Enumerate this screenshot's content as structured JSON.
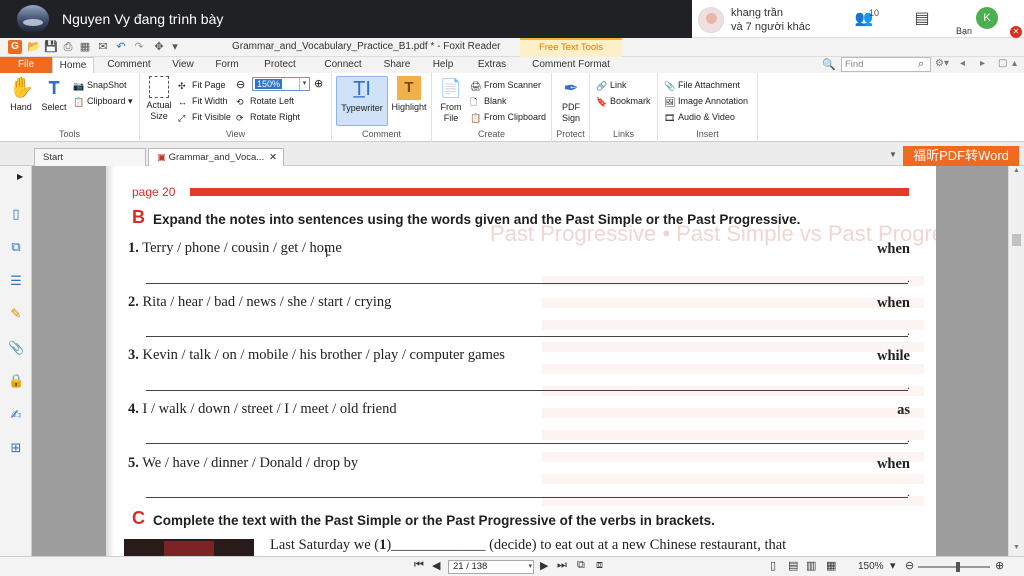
{
  "meeting": {
    "presenter_text": "Nguyen Vy đang trình bày",
    "others_name": "khang trần",
    "others_sub": "và 7 người khác",
    "people_count": "10",
    "self_initial": "K",
    "self_label": "Bạn"
  },
  "app": {
    "window_title": "Grammar_and_Vocabulary_Practice_B1.pdf * - Foxit Reader",
    "context_tab": "Free Text Tools"
  },
  "tabs": {
    "file": "File",
    "items": [
      "Home",
      "Comment",
      "View",
      "Form",
      "Protect",
      "Connect",
      "Share",
      "Help",
      "Extras",
      "Comment Format"
    ],
    "find_placeholder": "Find"
  },
  "ribbon": {
    "tools": {
      "label": "Tools",
      "hand": "Hand",
      "select": "Select",
      "snapshot": "SnapShot",
      "clipboard": "Clipboard"
    },
    "view": {
      "label": "View",
      "actual_size": "Actual Size",
      "fit_page": "Fit Page",
      "fit_width": "Fit Width",
      "fit_visible": "Fit Visible",
      "rotate_left": "Rotate Left",
      "rotate_right": "Rotate Right",
      "zoom": "150%"
    },
    "comment": {
      "label": "Comment",
      "typewriter": "Typewriter",
      "highlight": "Highlight"
    },
    "create": {
      "label": "Create",
      "from_file": "From File",
      "from_scanner": "From Scanner",
      "blank": "Blank",
      "from_clipboard": "From Clipboard"
    },
    "protect": {
      "label": "Protect",
      "pdf_sign": "PDF Sign"
    },
    "links": {
      "label": "Links",
      "link": "Link",
      "bookmark": "Bookmark"
    },
    "insert": {
      "label": "Insert",
      "file_attachment": "File Attachment",
      "image_annotation": "Image Annotation",
      "audio_video": "Audio & Video"
    }
  },
  "doc_tabs": {
    "start": "Start",
    "current": "Grammar_and_Voca...",
    "promo": "福昕PDF转Word"
  },
  "page": {
    "page_num": "page 20",
    "ghost": "Past Progressive • Past Simple vs Past Progressive",
    "section_b": {
      "letter": "B",
      "title": "Expand the notes into sentences using the words given and the Past Simple or the Past Progressive.",
      "items": [
        {
          "num": "1.",
          "text": "Terry / phone / cousin / get / home",
          "conj": "when"
        },
        {
          "num": "2.",
          "text": "Rita / hear / bad / news / she / start / crying",
          "conj": "when"
        },
        {
          "num": "3.",
          "text": "Kevin / talk / on / mobile / his brother / play / computer games",
          "conj": "while"
        },
        {
          "num": "4.",
          "text": "I / walk / down / street / I / meet / old friend",
          "conj": "as"
        },
        {
          "num": "5.",
          "text": "We / have / dinner / Donald / drop by",
          "conj": "when"
        }
      ]
    },
    "section_c": {
      "letter": "C",
      "title": "Complete the text with the Past Simple or the Past Progressive of the verbs in brackets.",
      "first_line_a": "Last Saturday we (",
      "first_line_num": "1",
      "first_line_b": ")_____________ (decide) to eat out at a new Chinese restaurant, that"
    }
  },
  "status": {
    "page_field": "21 / 138",
    "zoom": "150%"
  }
}
